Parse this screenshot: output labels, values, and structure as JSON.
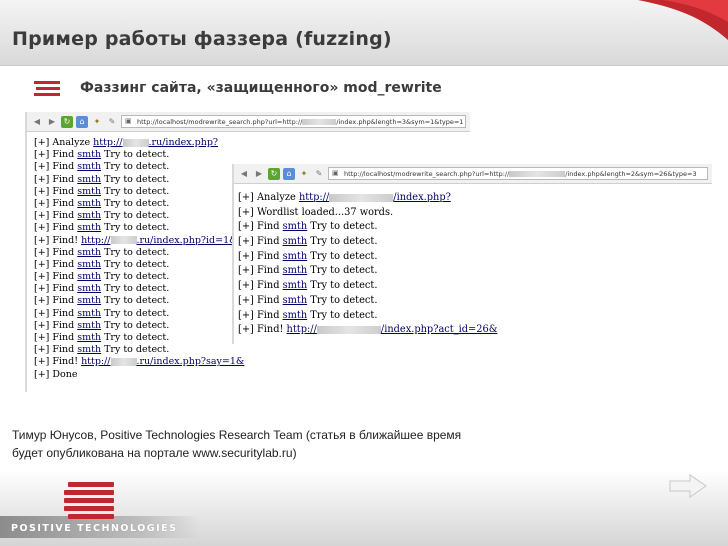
{
  "slide": {
    "title": "Пример работы фаззера (fuzzing)",
    "subtitle": "Фаззинг сайта, «защищенного» mod_rewrite",
    "caption_line1": "Тимур Юнусов, Positive Technologies Research Team (статья в ближайшее время",
    "caption_line2": "будет опубликована на портале www.securitylab.ru)",
    "logo_text": "POSITIVE  TECHNOLOGIES",
    "accent_color": "#c1272d"
  },
  "shot1": {
    "address": "http://localhost/modrewrite_search.php?url=http://",
    "address_tail": "/index.php&length=3&sym=1&type=1",
    "lines": [
      {
        "pre": "[+] Analyze ",
        "link": "http://",
        "link2": ".ru/index.php?",
        "post": ""
      },
      {
        "pre": "[+] Find ",
        "link": "smth",
        "post": " Try to detect."
      },
      {
        "pre": "[+] Find ",
        "link": "smth",
        "post": " Try to detect."
      },
      {
        "pre": "[+] Find ",
        "link": "smth",
        "post": " Try to detect."
      },
      {
        "pre": "[+] Find ",
        "link": "smth",
        "post": " Try to detect."
      },
      {
        "pre": "[+] Find ",
        "link": "smth",
        "post": " Try to detect."
      },
      {
        "pre": "[+] Find ",
        "link": "smth",
        "post": " Try to detect."
      },
      {
        "pre": "[+] Find ",
        "link": "smth",
        "post": " Try to detect."
      },
      {
        "pre": "[+] Find! ",
        "link": "http://",
        "link2": ".ru/index.php?id=1&",
        "post": ""
      },
      {
        "pre": "[+] Find ",
        "link": "smth",
        "post": " Try to detect."
      },
      {
        "pre": "[+] Find ",
        "link": "smth",
        "post": " Try to detect."
      },
      {
        "pre": "[+] Find ",
        "link": "smth",
        "post": " Try to detect."
      },
      {
        "pre": "[+] Find ",
        "link": "smth",
        "post": " Try to detect."
      },
      {
        "pre": "[+] Find ",
        "link": "smth",
        "post": " Try to detect."
      },
      {
        "pre": "[+] Find ",
        "link": "smth",
        "post": " Try to detect."
      },
      {
        "pre": "[+] Find ",
        "link": "smth",
        "post": " Try to detect."
      },
      {
        "pre": "[+] Find ",
        "link": "smth",
        "post": " Try to detect."
      },
      {
        "pre": "[+] Find ",
        "link": "smth",
        "post": " Try to detect."
      },
      {
        "pre": "[+] Find! ",
        "link": "http://",
        "link2": ".ru/index.php?say=1&",
        "post": ""
      },
      {
        "pre": "[+] Done",
        "link": "",
        "post": ""
      }
    ]
  },
  "shot2": {
    "address": "http://localhost/modrewrite_search.php?url=http://",
    "address_tail": "/index.php&length=2&sym=26&type=3",
    "lines": [
      {
        "pre": "[+] Analyze ",
        "link": "http://",
        "link2": "/index.php?",
        "post": ""
      },
      {
        "pre": "[+] Wordlist loaded...37 words.",
        "link": "",
        "post": ""
      },
      {
        "pre": "[+] Find ",
        "link": "smth",
        "post": " Try to detect."
      },
      {
        "pre": "[+] Find ",
        "link": "smth",
        "post": " Try to detect."
      },
      {
        "pre": "[+] Find ",
        "link": "smth",
        "post": " Try to detect."
      },
      {
        "pre": "[+] Find ",
        "link": "smth",
        "post": " Try to detect."
      },
      {
        "pre": "[+] Find ",
        "link": "smth",
        "post": " Try to detect."
      },
      {
        "pre": "[+] Find ",
        "link": "smth",
        "post": " Try to detect."
      },
      {
        "pre": "[+] Find ",
        "link": "smth",
        "post": " Try to detect."
      },
      {
        "pre": "[+] Find! ",
        "link": "http://",
        "link2": "/index.php?act_id=26&",
        "post": ""
      }
    ]
  }
}
